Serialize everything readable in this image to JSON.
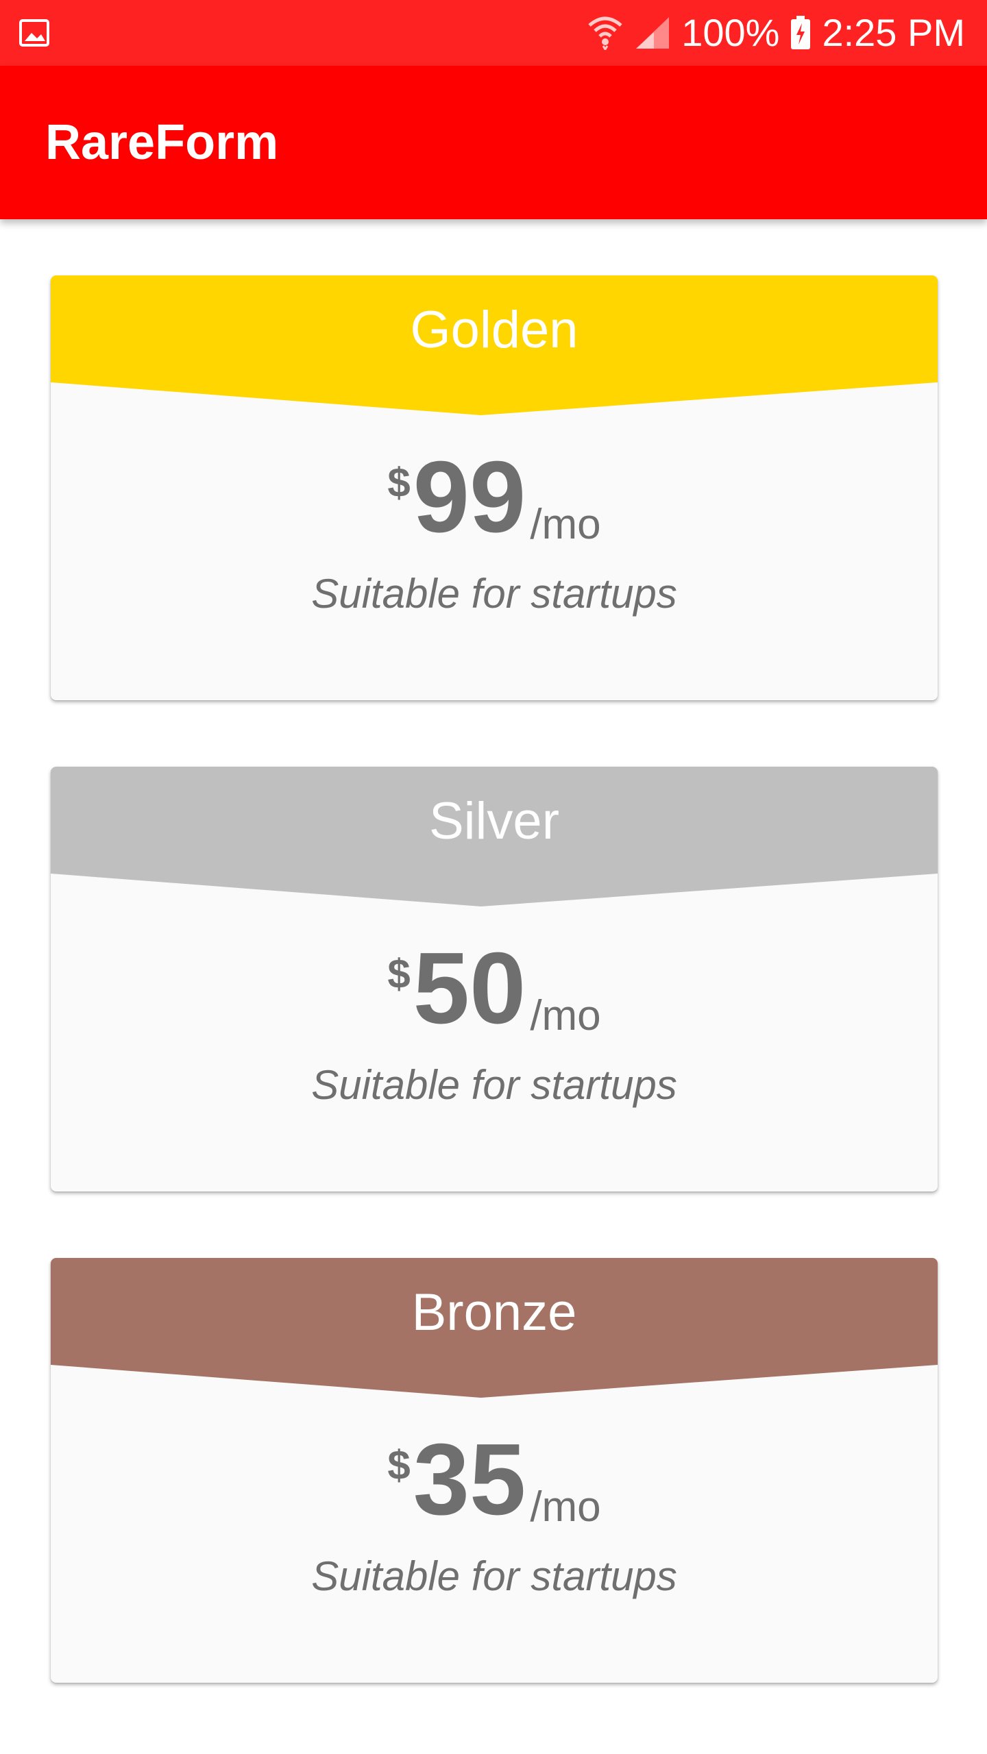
{
  "status_bar": {
    "left_icon": "gallery-icon",
    "wifi_icon": "wifi-icon",
    "signal_icon": "signal-icon",
    "battery_percent": "100%",
    "battery_icon": "battery-charging-icon",
    "time": "2:25 PM",
    "color": "#ff2222"
  },
  "app_bar": {
    "title": "RareForm",
    "color": "#ff0000"
  },
  "plans": [
    {
      "name": "Golden",
      "currency": "$",
      "amount": "99",
      "period": "/mo",
      "description": "Suitable for startups",
      "color": "#ffd600"
    },
    {
      "name": "Silver",
      "currency": "$",
      "amount": "50",
      "period": "/mo",
      "description": "Suitable for startups",
      "color": "#bfbfbf"
    },
    {
      "name": "Bronze",
      "currency": "$",
      "amount": "35",
      "period": "/mo",
      "description": "Suitable for startups",
      "color": "#a57365"
    }
  ]
}
